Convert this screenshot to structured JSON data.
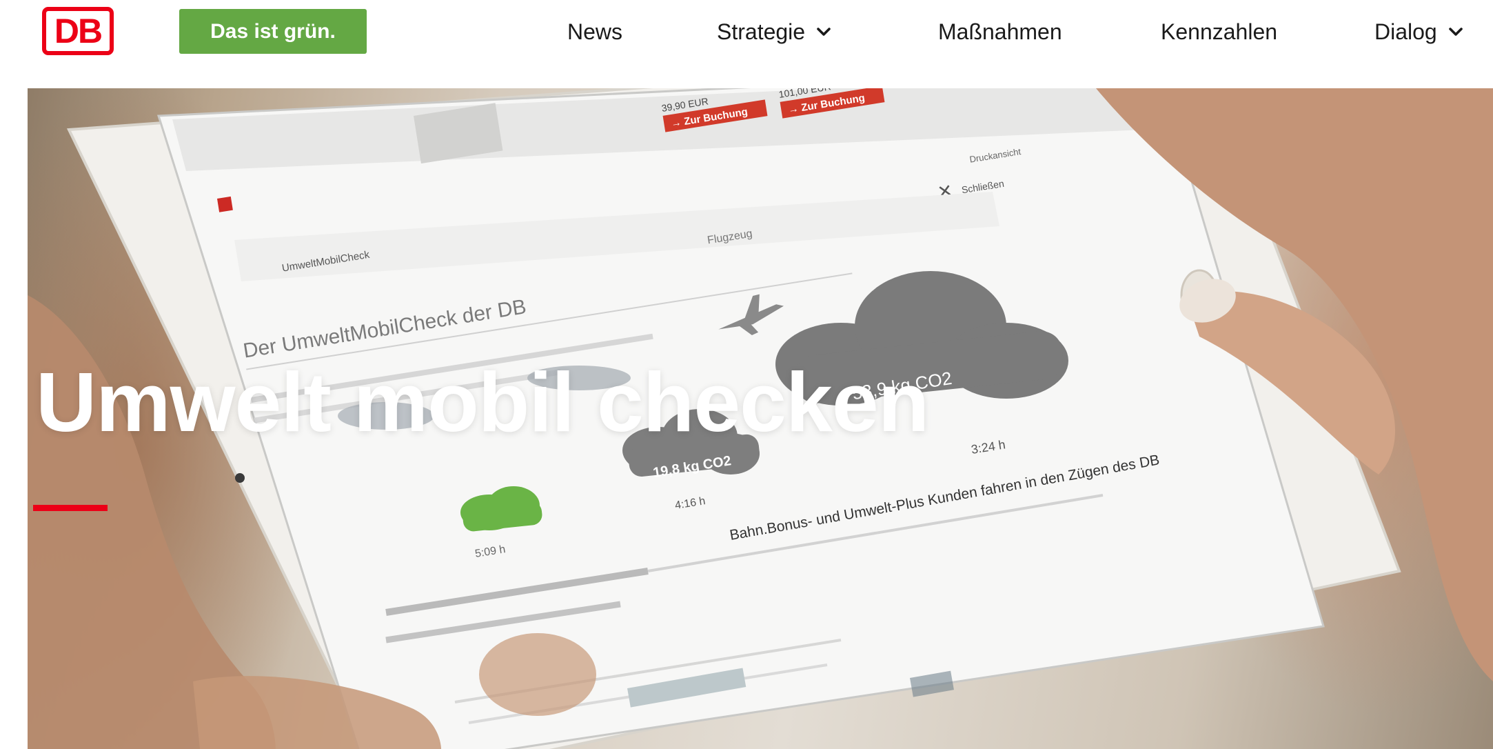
{
  "brand": {
    "logo_text": "DB",
    "badge_label": "Das ist grün."
  },
  "nav": {
    "items": [
      {
        "label": "News",
        "has_dropdown": false
      },
      {
        "label": "Strategie",
        "has_dropdown": true
      },
      {
        "label": "Maßnahmen",
        "has_dropdown": false
      },
      {
        "label": "Kennzahlen",
        "has_dropdown": false
      },
      {
        "label": "Dialog",
        "has_dropdown": true
      }
    ]
  },
  "hero": {
    "title": "Umwelt mobil checken",
    "image_subject": "tablet-umweltmobilcheck-photo",
    "screen_texts": {
      "heading": "Der UmweltMobilCheck der DB",
      "cloud_flight": "53,9 kg CO2",
      "cloud_car": "19,8 kg CO2",
      "time_flight": "3:24 h",
      "time_car": "4:16 h",
      "time_train": "5:09 h",
      "price_1": "39,90 EUR",
      "price_2": "101,00 EUR",
      "booking_label": "Zur Buchung",
      "close_label": "Schließen",
      "flight_label": "Flugzeug",
      "print_label": "Druckansicht",
      "tab_label": "UmweltMobilCheck",
      "notice": "Bahn.Bonus- und Umwelt-Plus Kunden fahren in den Zügen des DB"
    }
  },
  "colors": {
    "db_red": "#ec0016",
    "badge_green": "#64a844",
    "nav_text": "#1a1a1a",
    "hero_title": "#ffffff"
  }
}
